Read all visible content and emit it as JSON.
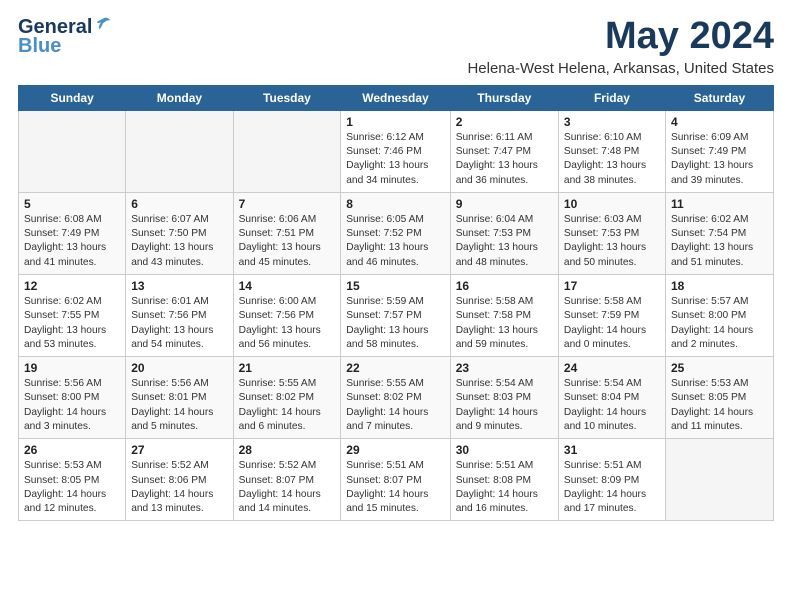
{
  "logo": {
    "line1": "General",
    "line2": "Blue"
  },
  "title": {
    "month": "May 2024",
    "location": "Helena-West Helena, Arkansas, United States"
  },
  "weekdays": [
    "Sunday",
    "Monday",
    "Tuesday",
    "Wednesday",
    "Thursday",
    "Friday",
    "Saturday"
  ],
  "weeks": [
    [
      {
        "day": "",
        "info": ""
      },
      {
        "day": "",
        "info": ""
      },
      {
        "day": "",
        "info": ""
      },
      {
        "day": "1",
        "info": "Sunrise: 6:12 AM\nSunset: 7:46 PM\nDaylight: 13 hours\nand 34 minutes."
      },
      {
        "day": "2",
        "info": "Sunrise: 6:11 AM\nSunset: 7:47 PM\nDaylight: 13 hours\nand 36 minutes."
      },
      {
        "day": "3",
        "info": "Sunrise: 6:10 AM\nSunset: 7:48 PM\nDaylight: 13 hours\nand 38 minutes."
      },
      {
        "day": "4",
        "info": "Sunrise: 6:09 AM\nSunset: 7:49 PM\nDaylight: 13 hours\nand 39 minutes."
      }
    ],
    [
      {
        "day": "5",
        "info": "Sunrise: 6:08 AM\nSunset: 7:49 PM\nDaylight: 13 hours\nand 41 minutes."
      },
      {
        "day": "6",
        "info": "Sunrise: 6:07 AM\nSunset: 7:50 PM\nDaylight: 13 hours\nand 43 minutes."
      },
      {
        "day": "7",
        "info": "Sunrise: 6:06 AM\nSunset: 7:51 PM\nDaylight: 13 hours\nand 45 minutes."
      },
      {
        "day": "8",
        "info": "Sunrise: 6:05 AM\nSunset: 7:52 PM\nDaylight: 13 hours\nand 46 minutes."
      },
      {
        "day": "9",
        "info": "Sunrise: 6:04 AM\nSunset: 7:53 PM\nDaylight: 13 hours\nand 48 minutes."
      },
      {
        "day": "10",
        "info": "Sunrise: 6:03 AM\nSunset: 7:53 PM\nDaylight: 13 hours\nand 50 minutes."
      },
      {
        "day": "11",
        "info": "Sunrise: 6:02 AM\nSunset: 7:54 PM\nDaylight: 13 hours\nand 51 minutes."
      }
    ],
    [
      {
        "day": "12",
        "info": "Sunrise: 6:02 AM\nSunset: 7:55 PM\nDaylight: 13 hours\nand 53 minutes."
      },
      {
        "day": "13",
        "info": "Sunrise: 6:01 AM\nSunset: 7:56 PM\nDaylight: 13 hours\nand 54 minutes."
      },
      {
        "day": "14",
        "info": "Sunrise: 6:00 AM\nSunset: 7:56 PM\nDaylight: 13 hours\nand 56 minutes."
      },
      {
        "day": "15",
        "info": "Sunrise: 5:59 AM\nSunset: 7:57 PM\nDaylight: 13 hours\nand 58 minutes."
      },
      {
        "day": "16",
        "info": "Sunrise: 5:58 AM\nSunset: 7:58 PM\nDaylight: 13 hours\nand 59 minutes."
      },
      {
        "day": "17",
        "info": "Sunrise: 5:58 AM\nSunset: 7:59 PM\nDaylight: 14 hours\nand 0 minutes."
      },
      {
        "day": "18",
        "info": "Sunrise: 5:57 AM\nSunset: 8:00 PM\nDaylight: 14 hours\nand 2 minutes."
      }
    ],
    [
      {
        "day": "19",
        "info": "Sunrise: 5:56 AM\nSunset: 8:00 PM\nDaylight: 14 hours\nand 3 minutes."
      },
      {
        "day": "20",
        "info": "Sunrise: 5:56 AM\nSunset: 8:01 PM\nDaylight: 14 hours\nand 5 minutes."
      },
      {
        "day": "21",
        "info": "Sunrise: 5:55 AM\nSunset: 8:02 PM\nDaylight: 14 hours\nand 6 minutes."
      },
      {
        "day": "22",
        "info": "Sunrise: 5:55 AM\nSunset: 8:02 PM\nDaylight: 14 hours\nand 7 minutes."
      },
      {
        "day": "23",
        "info": "Sunrise: 5:54 AM\nSunset: 8:03 PM\nDaylight: 14 hours\nand 9 minutes."
      },
      {
        "day": "24",
        "info": "Sunrise: 5:54 AM\nSunset: 8:04 PM\nDaylight: 14 hours\nand 10 minutes."
      },
      {
        "day": "25",
        "info": "Sunrise: 5:53 AM\nSunset: 8:05 PM\nDaylight: 14 hours\nand 11 minutes."
      }
    ],
    [
      {
        "day": "26",
        "info": "Sunrise: 5:53 AM\nSunset: 8:05 PM\nDaylight: 14 hours\nand 12 minutes."
      },
      {
        "day": "27",
        "info": "Sunrise: 5:52 AM\nSunset: 8:06 PM\nDaylight: 14 hours\nand 13 minutes."
      },
      {
        "day": "28",
        "info": "Sunrise: 5:52 AM\nSunset: 8:07 PM\nDaylight: 14 hours\nand 14 minutes."
      },
      {
        "day": "29",
        "info": "Sunrise: 5:51 AM\nSunset: 8:07 PM\nDaylight: 14 hours\nand 15 minutes."
      },
      {
        "day": "30",
        "info": "Sunrise: 5:51 AM\nSunset: 8:08 PM\nDaylight: 14 hours\nand 16 minutes."
      },
      {
        "day": "31",
        "info": "Sunrise: 5:51 AM\nSunset: 8:09 PM\nDaylight: 14 hours\nand 17 minutes."
      },
      {
        "day": "",
        "info": ""
      }
    ]
  ]
}
